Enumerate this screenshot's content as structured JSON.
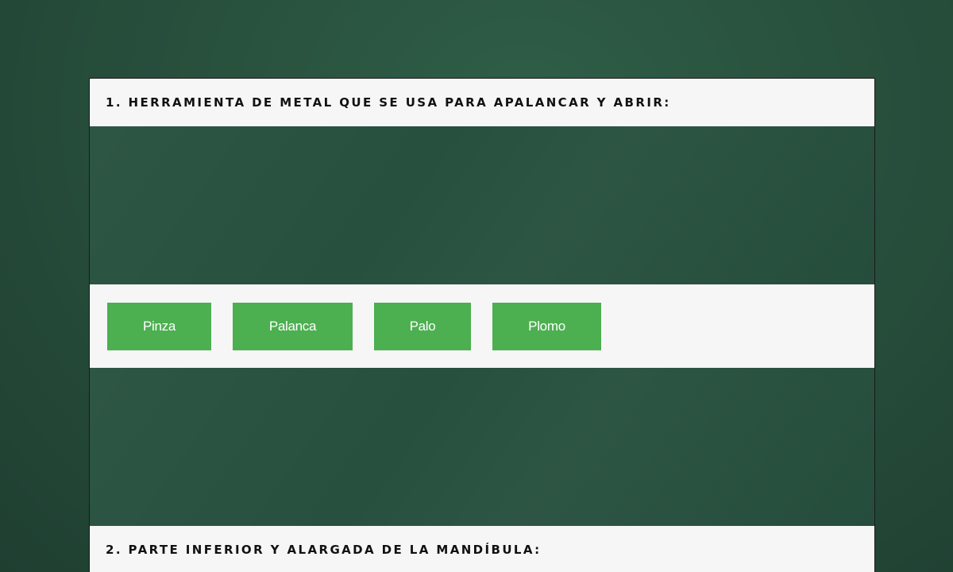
{
  "questions": [
    {
      "text": "1. HERRAMIENTA DE METAL QUE SE USA PARA APALANCAR Y ABRIR:",
      "options": [
        "Pinza",
        "Palanca",
        "Palo",
        "Plomo"
      ]
    },
    {
      "text": "2. PARTE INFERIOR Y ALARGADA DE LA MANDÍBULA:"
    }
  ],
  "colors": {
    "background": "#28503d",
    "button": "#4caf50",
    "panel": "#f6f6f6"
  }
}
